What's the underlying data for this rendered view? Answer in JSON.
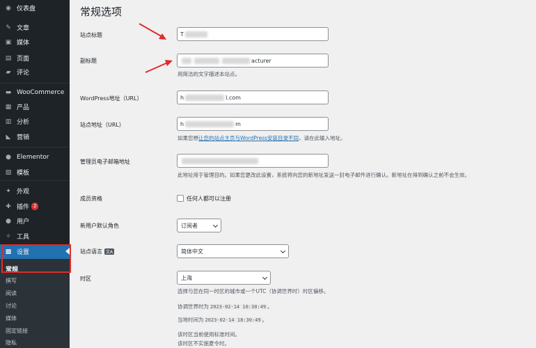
{
  "sidebar": {
    "items": [
      {
        "icon": "dashboard-icon",
        "glyph": "◉",
        "label": "仪表盘"
      },
      {
        "icon": "pin-icon",
        "glyph": "✎",
        "label": "文章"
      },
      {
        "icon": "media-icon",
        "glyph": "▣",
        "label": "媒体"
      },
      {
        "icon": "page-icon",
        "glyph": "▤",
        "label": "页面"
      },
      {
        "icon": "comment-icon",
        "glyph": "▰",
        "label": "评论"
      },
      {
        "icon": "woocommerce-icon",
        "glyph": "▬",
        "label": "WooCommerce"
      },
      {
        "icon": "products-icon",
        "glyph": "▦",
        "label": "产品"
      },
      {
        "icon": "analytics-icon",
        "glyph": "▥",
        "label": "分析"
      },
      {
        "icon": "marketing-icon",
        "glyph": "◣",
        "label": "营销"
      },
      {
        "icon": "elementor-icon",
        "glyph": "●",
        "label": "Elementor"
      },
      {
        "icon": "templates-icon",
        "glyph": "▧",
        "label": "模板"
      },
      {
        "icon": "appearance-icon",
        "glyph": "✦",
        "label": "外观"
      },
      {
        "icon": "plugins-icon",
        "glyph": "✚",
        "label": "插件",
        "badge": "2"
      },
      {
        "icon": "users-icon",
        "glyph": "●",
        "label": "用户"
      },
      {
        "icon": "tools-icon",
        "glyph": "✧",
        "label": "工具"
      },
      {
        "icon": "settings-icon",
        "glyph": "▩",
        "label": "设置"
      }
    ],
    "submenu": [
      "常规",
      "撰写",
      "阅读",
      "讨论",
      "媒体",
      "固定链接",
      "隐私"
    ]
  },
  "page": {
    "title": "常规选项",
    "site_title_label": "站点标题",
    "site_title_value": "T",
    "tagline_label": "副标题",
    "tagline_value_tail": "acturer",
    "tagline_desc": "用简洁的文字描述本站点。",
    "wp_url_label": "WordPress地址（URL）",
    "wp_url_head": "h",
    "wp_url_tail": "l.com",
    "site_url_label": "站点地址（URL）",
    "site_url_head": "h",
    "site_url_tail": "m",
    "site_url_desc_pre": "如果您想",
    "site_url_desc_link": "让您的站点主页与WordPress安装目录不同",
    "site_url_desc_post": "，请在此输入地址。",
    "admin_email_label": "管理员电子邮箱地址",
    "admin_email_desc": "此地址用于管理目的。如果您更改此设置，系统将向您的新地址发送一封电子邮件进行确认。新地址在得到确认之前不会生效。",
    "membership_label": "成员资格",
    "membership_checkbox": "任何人都可以注册",
    "default_role_label": "新用户默认角色",
    "default_role_value": "订阅者",
    "site_language_label": "站点语言",
    "site_language_icon": "文A",
    "site_language_value": "简体中文",
    "timezone_label": "时区",
    "timezone_value": "上海",
    "timezone_desc": "选择与您在同一时区的城市或一个UTC（协调世界时）时区偏移。",
    "utc_time_pre": "协调世界时为",
    "utc_time_value": "2023-02-14 10:30:49",
    "utc_time_post": "。",
    "local_time_pre": "当地时间为",
    "local_time_value": "2023-02-14 18:30:49",
    "local_time_post": "。",
    "dst_note_1": "该时区当前使用标准时间。",
    "dst_note_2": "该时区不实施夏令时。"
  },
  "colors": {
    "sidebar_bg": "#1d2327",
    "active_bg": "#2271b1",
    "highlight_red": "#e02b2b",
    "link_blue": "#2271b1"
  }
}
